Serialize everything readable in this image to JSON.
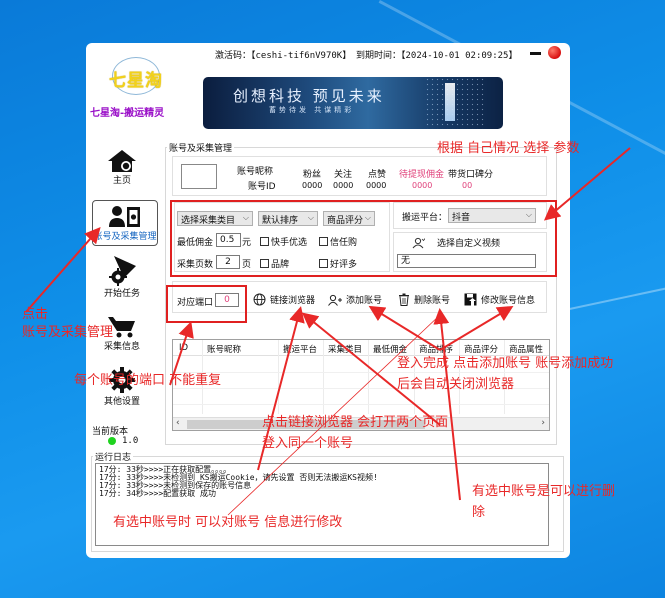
{
  "window": {
    "activation_label": "激活码：",
    "activation_code": "【ceshi-tif6nV970K】",
    "expiry_label": "到期时间：",
    "expiry_value": "【2024-10-01 02:09:25】"
  },
  "brand": {
    "logo_text": "七星淘",
    "subtitle": "七星淘-搬运精灵",
    "banner_title": "创想科技 预见未来",
    "banner_subtitle": "蓄势待发 共谋精彩"
  },
  "sidebar": {
    "items": [
      {
        "label": "主页",
        "icon": "home-icon"
      },
      {
        "label": "账号及采集管理",
        "icon": "account-card-icon",
        "active": true
      },
      {
        "label": "开始任务",
        "icon": "start-task-icon"
      },
      {
        "label": "采集信息",
        "icon": "cart-icon"
      },
      {
        "label": "其他设置",
        "icon": "gear-icon"
      }
    ],
    "version_label": "当前版本",
    "version_value": "1.0",
    "version_status_color": "#1fd31f"
  },
  "account_section": {
    "title": "账号及采集管理",
    "nickname_label": "账号昵称",
    "id_label": "账号ID",
    "stats": [
      {
        "label": "粉丝",
        "value": "0000"
      },
      {
        "label": "关注",
        "value": "0000"
      },
      {
        "label": "点赞",
        "value": "0000"
      },
      {
        "label": "待提现佣金",
        "value": "0000",
        "highlight": true
      },
      {
        "label": "带货口碑分",
        "value": "00",
        "highlight_value": true
      }
    ]
  },
  "filters": {
    "category_select": "选择采集类目",
    "sort_select": "默认排序",
    "rating_select": "商品评分",
    "min_commission_label": "最低佣金",
    "min_commission_value": "0.5",
    "min_commission_unit": "元",
    "pages_label": "采集页数",
    "pages_value": "2",
    "pages_unit": "页",
    "checkboxes": [
      {
        "label": "快手优选",
        "checked": false
      },
      {
        "label": "信任购",
        "checked": false
      },
      {
        "label": "品牌",
        "checked": false
      },
      {
        "label": "好评多",
        "checked": false
      }
    ],
    "platform_label": "搬运平台：",
    "platform_value": "抖音",
    "custom_video_label": "选择自定义视频",
    "custom_video_value": "无"
  },
  "toolbar": {
    "port_label": "对应端口",
    "port_value": "0",
    "link_browser": "链接浏览器",
    "add_account": "添加账号",
    "delete_account": "删除账号",
    "edit_account": "修改账号信息"
  },
  "table": {
    "columns": [
      "ID",
      "账号昵称",
      "搬运平台",
      "采集类目",
      "最低佣金",
      "商品排序",
      "商品评分",
      "商品属性"
    ],
    "rows": []
  },
  "log": {
    "title": "运行日志",
    "lines": [
      "17分: 33秒>>>>正在获取配置。。。。",
      "17分: 33秒>>>>未检测到 KS搬运Cookie，请先设置 否则无法搬运KS视频!",
      "17分: 33秒>>>>未检测到保存的账号信息",
      "17分: 34秒>>>>配置获取 成功"
    ]
  },
  "annotations": {
    "choose_params": "根据 自己情况 选择  参数",
    "click_account_1": "点击",
    "click_account_2": "账号及采集管理",
    "port_unique": "每个账号的端口 不能重复",
    "login_done_1": "登入完成 点击添加账号 账号添加成功",
    "login_done_2": "后会自动关闭浏览器",
    "link_browser_1": "点击链接浏览器 会打开两个页面",
    "link_browser_2": "登入同一个账号",
    "delete_1": "有选中账号是可以进行删",
    "delete_2": "除",
    "edit": "有选中账号时 可以对账号 信息进行修改"
  }
}
